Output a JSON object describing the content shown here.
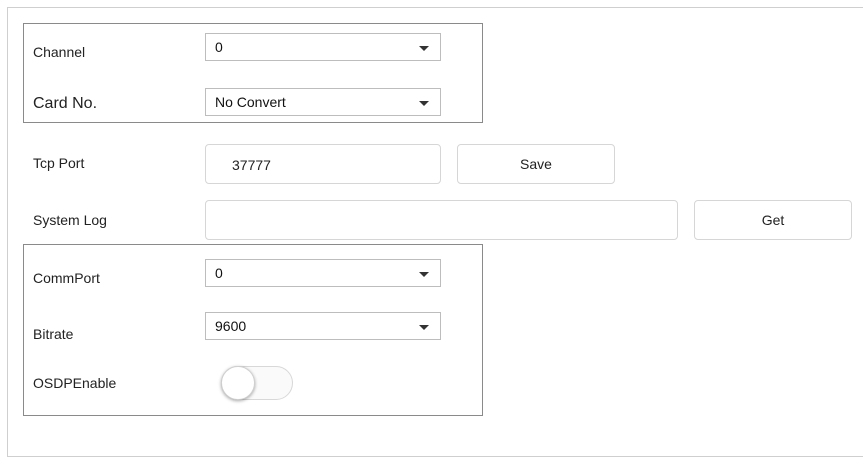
{
  "channel_group": {
    "channel": {
      "label": "Channel",
      "value": "0"
    },
    "card_no": {
      "label": "Card No.",
      "value": "No Convert"
    }
  },
  "tcp_port": {
    "label": "Tcp Port",
    "value": "37777",
    "button_label": "Save"
  },
  "system_log": {
    "label": "System Log",
    "value": "",
    "button_label": "Get"
  },
  "comm_group": {
    "comm_port": {
      "label": "CommPort",
      "value": "0"
    },
    "bitrate": {
      "label": "Bitrate",
      "value": "9600"
    },
    "osdp_enable": {
      "label": "OSDPEnable",
      "enabled": false
    }
  }
}
